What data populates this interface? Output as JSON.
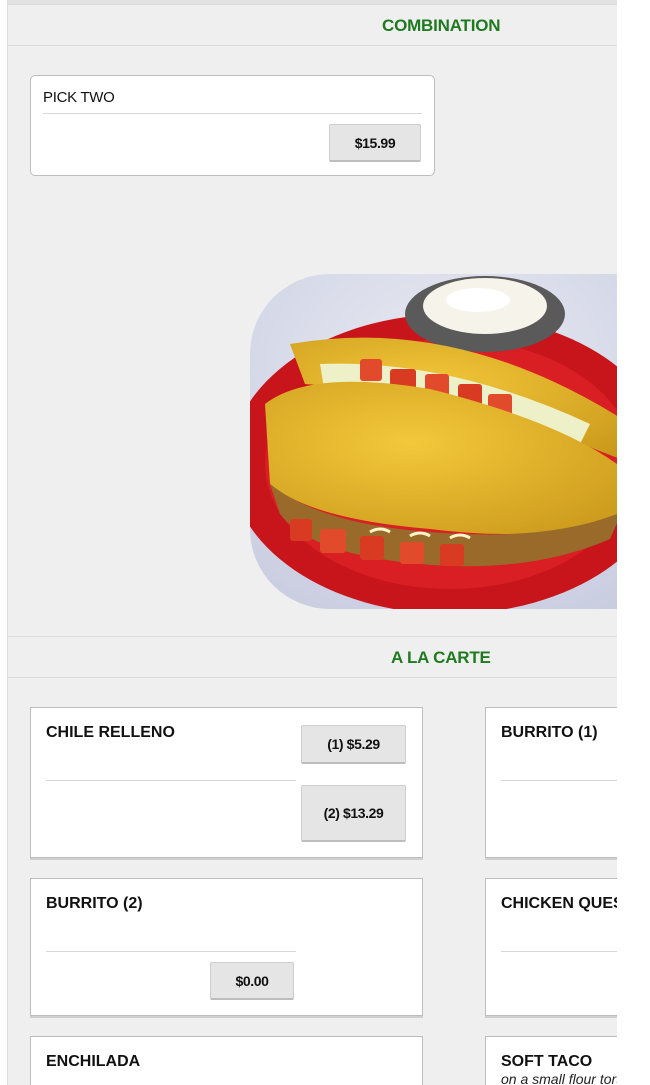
{
  "sections": {
    "combination": {
      "title": "COMBINATION",
      "items": [
        {
          "name": "PICK TWO",
          "price": "$15.99"
        }
      ]
    },
    "a_la_carte": {
      "title": "A LA CARTE",
      "items": [
        {
          "name": "CHILE RELLENO",
          "prices": [
            "(1) $5.29",
            "(2) $13.29"
          ]
        },
        {
          "name": "BURRITO (1)"
        },
        {
          "name": "BURRITO (2)",
          "price": "$0.00"
        },
        {
          "name": "CHICKEN QUESADILLA"
        },
        {
          "name": "ENCHILADA"
        },
        {
          "name": "SOFT TACO",
          "subtitle": "on a small flour tortilla"
        }
      ]
    }
  },
  "image": {
    "description_icon": "taco-plate-photo"
  },
  "colors": {
    "section_title": "#1f7a1f",
    "panel_bg": "#efefef",
    "button_bg": "#e5e5e5"
  }
}
